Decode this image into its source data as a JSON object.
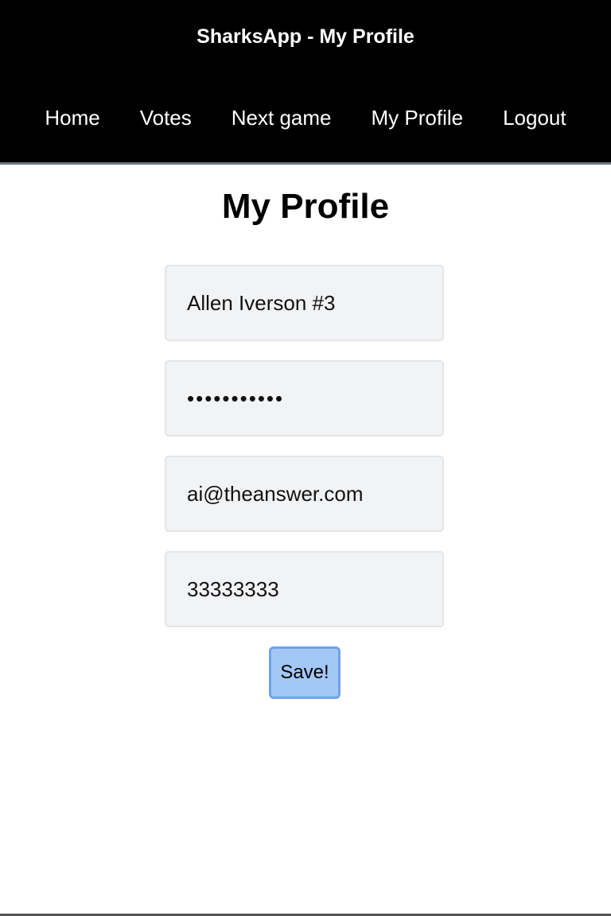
{
  "header": {
    "title": "SharksApp - My Profile",
    "nav": [
      {
        "label": "Home"
      },
      {
        "label": "Votes"
      },
      {
        "label": "Next game"
      },
      {
        "label": "My Profile"
      },
      {
        "label": "Logout"
      }
    ]
  },
  "main": {
    "title": "My Profile",
    "fields": {
      "name_value": "Allen Iverson #3",
      "password_value": "•••••••••••",
      "email_value": "ai@theanswer.com",
      "phone_value": "33333333"
    },
    "save_label": "Save!"
  },
  "colors": {
    "header_bg": "#000000",
    "field_bg": "#f2f3f5",
    "button_bg": "#a3c8f6",
    "button_border": "#6fa2ec"
  }
}
